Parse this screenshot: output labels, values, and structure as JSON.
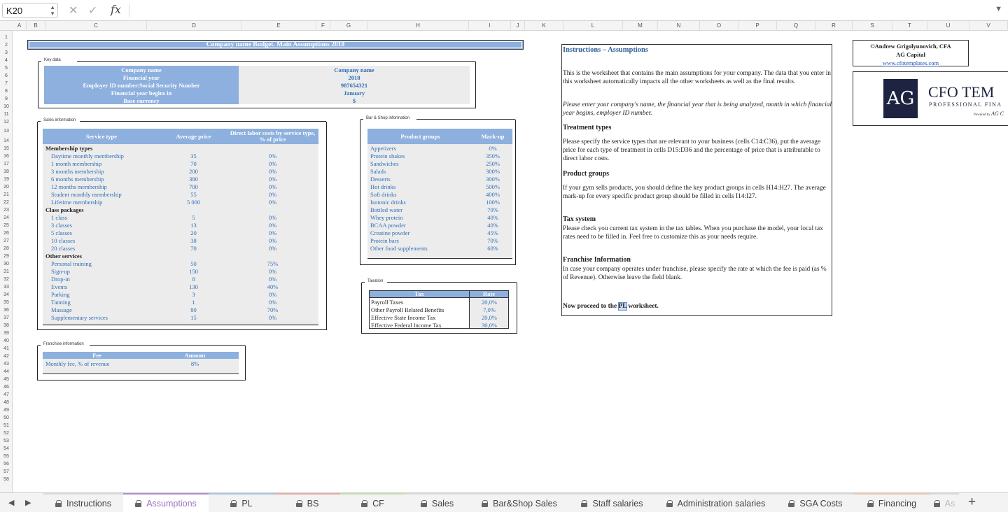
{
  "formula_bar": {
    "name_box": "K20",
    "fx": "fx",
    "cancel": "✕",
    "enter": "✓"
  },
  "columns": [
    "A",
    "B",
    "C",
    "D",
    "E",
    "F",
    "G",
    "H",
    "I",
    "J",
    "K",
    "L",
    "M",
    "N",
    "O",
    "P",
    "Q",
    "R",
    "S",
    "T",
    "U",
    "V"
  ],
  "rows": [
    "1",
    "2",
    "3",
    "4",
    "5",
    "6",
    "7",
    "8",
    "9",
    "10",
    "11",
    "12",
    "13",
    "14",
    "15",
    "16",
    "17",
    "18",
    "19",
    "20",
    "21",
    "22",
    "23",
    "24",
    "25",
    "26",
    "27",
    "28",
    "29",
    "30",
    "31",
    "32",
    "33",
    "34",
    "35",
    "36",
    "37",
    "38",
    "39",
    "40",
    "41",
    "42",
    "43",
    "44",
    "45",
    "46",
    "47",
    "48",
    "49",
    "50",
    "51",
    "52",
    "53",
    "54",
    "55",
    "56",
    "57",
    "58"
  ],
  "title": "Company name Budget. Main Assumptions 2018",
  "key_data": {
    "caption": "Key data",
    "labels": [
      "Company name",
      "Financial year",
      "Employer ID number/Social Security Number",
      "Financial year begins in",
      "Base currency"
    ],
    "values": [
      "Company name",
      "2018",
      "987654321",
      "January",
      "$"
    ]
  },
  "sales": {
    "caption": "Sales information",
    "h1": "Service type",
    "h2": "Average price",
    "h3": "Direct labor costs by service type, % of price",
    "rows": [
      {
        "name": "Membership types",
        "price": "",
        "pct": "",
        "group": true
      },
      {
        "name": "Daytime monthly membership",
        "price": "35",
        "pct": "0%"
      },
      {
        "name": "1 month membership",
        "price": "70",
        "pct": "0%"
      },
      {
        "name": "3 months membership",
        "price": "200",
        "pct": "0%"
      },
      {
        "name": "6 months membership",
        "price": "380",
        "pct": "0%"
      },
      {
        "name": "12 months membership",
        "price": "700",
        "pct": "0%"
      },
      {
        "name": "Student monthly membership",
        "price": "55",
        "pct": "0%"
      },
      {
        "name": "Lifetime membership",
        "price": "5 000",
        "pct": "0%"
      },
      {
        "name": "Class packages",
        "price": "",
        "pct": "",
        "group": true
      },
      {
        "name": "1 class",
        "price": "5",
        "pct": "0%"
      },
      {
        "name": "3 classes",
        "price": "13",
        "pct": "0%"
      },
      {
        "name": "5 classes",
        "price": "20",
        "pct": "0%"
      },
      {
        "name": "10 classes",
        "price": "38",
        "pct": "0%"
      },
      {
        "name": "20 classes",
        "price": "70",
        "pct": "0%"
      },
      {
        "name": "Other services",
        "price": "",
        "pct": "",
        "group": true
      },
      {
        "name": "Personal training",
        "price": "50",
        "pct": "75%"
      },
      {
        "name": "Sign-up",
        "price": "150",
        "pct": "0%"
      },
      {
        "name": "Drop-in",
        "price": "8",
        "pct": "0%"
      },
      {
        "name": "Events",
        "price": "130",
        "pct": "40%"
      },
      {
        "name": "Parking",
        "price": "3",
        "pct": "0%"
      },
      {
        "name": "Tanning",
        "price": "1",
        "pct": "0%"
      },
      {
        "name": "Massage",
        "price": "80",
        "pct": "70%"
      },
      {
        "name": "Supplementary services",
        "price": "15",
        "pct": "0%"
      }
    ]
  },
  "shop": {
    "caption": "Bar & Shop information",
    "h1": "Product groups",
    "h2": "Mark-up",
    "rows": [
      {
        "name": "Appetizers",
        "val": "0%"
      },
      {
        "name": "Protein shakes",
        "val": "350%"
      },
      {
        "name": "Sandwiches",
        "val": "250%"
      },
      {
        "name": "Salads",
        "val": "300%"
      },
      {
        "name": "Desserts",
        "val": "300%"
      },
      {
        "name": "Hot drinks",
        "val": "500%"
      },
      {
        "name": "Soft drinks",
        "val": "400%"
      },
      {
        "name": "Isotonic drinks",
        "val": "100%"
      },
      {
        "name": "Bottled water",
        "val": "70%"
      },
      {
        "name": "Whey protein",
        "val": "40%"
      },
      {
        "name": "BCAA powder",
        "val": "40%"
      },
      {
        "name": "Creatine powder",
        "val": "45%"
      },
      {
        "name": "Protein bars",
        "val": "70%"
      },
      {
        "name": "Other food supplements",
        "val": "60%"
      }
    ]
  },
  "tax": {
    "caption": "Taxation",
    "h1": "Tax",
    "h2": "Rate",
    "rows": [
      {
        "name": "Payroll Taxes",
        "val": "20,0%"
      },
      {
        "name": "Other Payroll Related Benefits",
        "val": "7,0%"
      },
      {
        "name": "Effective State Income Tax",
        "val": "20,0%"
      },
      {
        "name": "Effective Federal Income Tax",
        "val": "30,0%"
      }
    ]
  },
  "franchise": {
    "caption": "Franchise information",
    "h1": "Fee",
    "h2": "Amount",
    "row": {
      "name": "Monthly fee, % of revenue",
      "val": "8%"
    }
  },
  "instructions": {
    "title": "Instructions – Assumptions",
    "p1": "This is the worksheet that contains the main assumptions for your company. The data that you enter in this worksheet automatically impacts all the other worksheets as well as the final results.",
    "p2": "Please enter your company's name, the financial year that is being analyzed, month in which financial year begins, employer ID number.",
    "h_treat": "Treatment types",
    "p3": "Please specify the service types that are relevant to your business (cells C14:C36), put the average price for each type of treatment in cells D15:D36 and the percentage of price that is attributable to direct labor costs.",
    "h_prod": "Product groups",
    "p4": "If your gym sells products, you should define the key product groups in cells H14:H27. The average mark-up for every specific product group should be filled in cells I14:I27.",
    "h_tax": "Tax system",
    "p5": "Please check you current tax system in the tax tables. When you purchase the model, your local tax rates need to be filled in. Feel free to customize this as your needs require.",
    "h_fr": "Franchise Information",
    "p6": "In case your company operates under franchise, please specify the rate at which the fee is paid (as % of Revenue). Otherwise leave the field blank.",
    "proceed_a": "Now proceed to the ",
    "proceed_hl": "PL",
    "proceed_b": " worksheet."
  },
  "credit": {
    "line1": "©Andrew Grigolyunovich, CFA",
    "line2": "AG Capital",
    "link": "www.cfotemplates.com"
  },
  "logo": {
    "mono": "AG",
    "brand": "CFO TEM",
    "sub": "PROFESSIONAL FINA",
    "powered": "Powered by",
    "pw2": "AG C"
  },
  "tabs": [
    {
      "label": "Instructions",
      "color": "#d9d9d9"
    },
    {
      "label": "Assumptions",
      "color": "#b38ccf",
      "active": true
    },
    {
      "label": "PL",
      "color": "#a9c4e8"
    },
    {
      "label": "BS",
      "color": "#e8a9a9"
    },
    {
      "label": "CF",
      "color": "#c6e0a9"
    },
    {
      "label": "Sales",
      "color": "#d9d9d9"
    },
    {
      "label": "Bar&Shop Sales",
      "color": "#d9d9d9"
    },
    {
      "label": "Staff salaries",
      "color": "#d9d9d9"
    },
    {
      "label": "Administration salaries",
      "color": "#d9d9d9"
    },
    {
      "label": "SGA Costs",
      "color": "#d9d9d9"
    },
    {
      "label": "Financing",
      "color": "#e8c9a9"
    },
    {
      "label": "As",
      "color": "#d9d9d9"
    }
  ],
  "add_sheet": "+",
  "nav_prev": "◀",
  "nav_next": "▶"
}
